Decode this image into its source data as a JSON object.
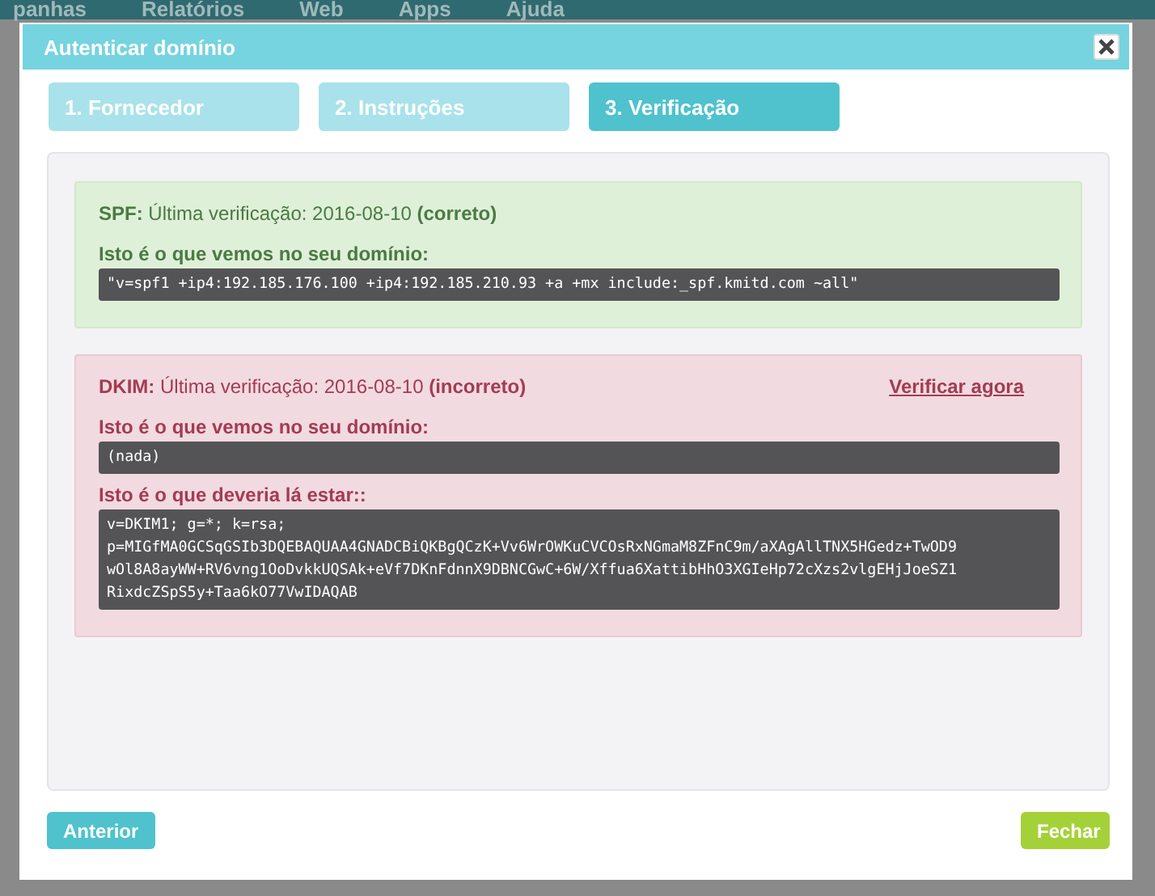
{
  "background_nav": {
    "items": [
      "panhas",
      "Relatórios",
      "Web",
      "Apps",
      "Ajuda"
    ]
  },
  "dialog": {
    "title": "Autenticar domínio"
  },
  "tabs": [
    {
      "label": "1. Fornecedor",
      "selected": false
    },
    {
      "label": "2. Instruções",
      "selected": false
    },
    {
      "label": "3. Verificação",
      "selected": true
    }
  ],
  "records": [
    {
      "kind": "success",
      "name": "SPF:",
      "checked_text": "Última verificação: 2016-08-10",
      "result": "(correto)",
      "blocks": [
        {
          "label": "Isto é o que vemos no seu domínio:",
          "code": "\"v=spf1 +ip4:192.185.176.100 +ip4:192.185.210.93 +a +mx include:_spf.kmitd.com ~all\""
        }
      ]
    },
    {
      "kind": "error",
      "name": "DKIM:",
      "checked_text": "Última verificação: 2016-08-10",
      "result": "(incorreto)",
      "link": "Verificar agora",
      "blocks": [
        {
          "label": "Isto é o que vemos no seu domínio:",
          "code": "(nada)"
        },
        {
          "label": "Isto é o que deveria lá estar::",
          "code": "v=DKIM1; g=*; k=rsa;\np=MIGfMA0GCSqGSIb3DQEBAQUAA4GNADCBiQKBgQCzK+Vv6WrOWKuCVCOsRxNGmaM8ZFnC9m/aXAgAllTNX5HGedz+TwOD9\nwOl8A8ayWW+RV6vng1OoDvkkUQSAk+eVf7DKnFdnnX9DBNCGwC+6W/Xffua6XattibHhO3XGIeHp72cXzs2vlgEHjJoeSZ1\nRixdcZSpS5y+Taa6kO77VwIDAQAB"
        }
      ]
    }
  ],
  "buttons": {
    "back": "Anterior",
    "close": "Fechar"
  }
}
